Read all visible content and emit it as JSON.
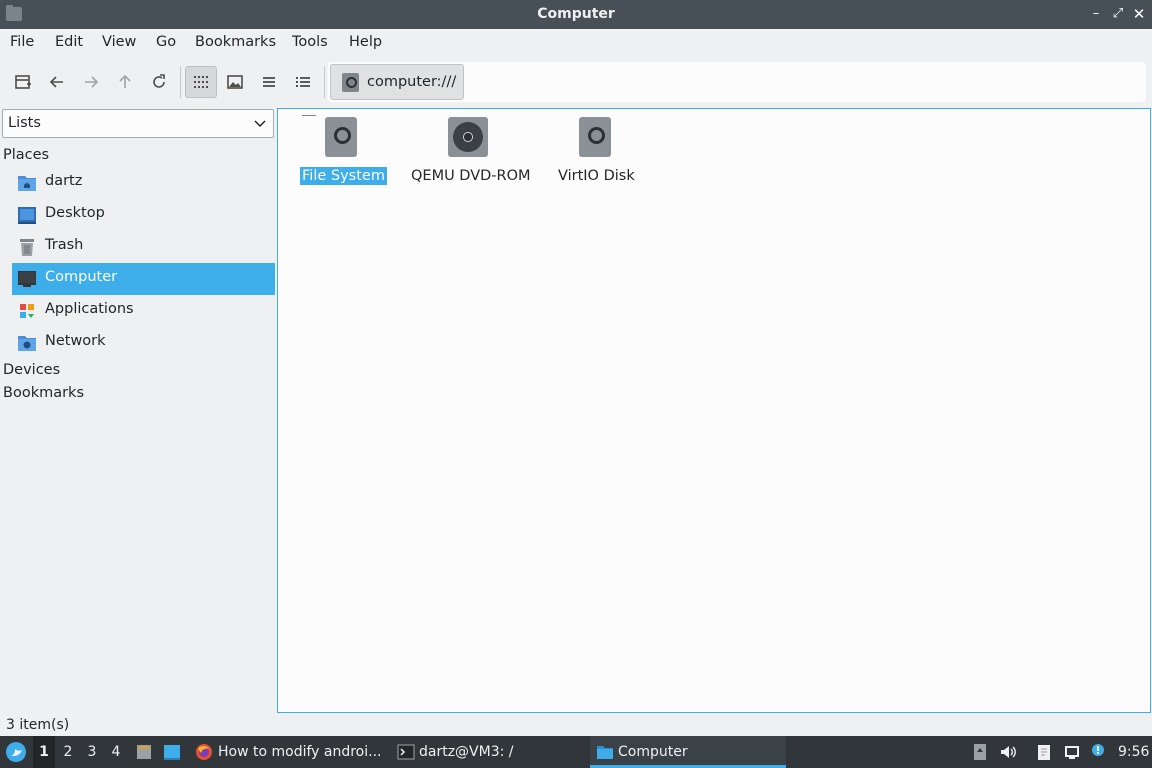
{
  "window": {
    "title": "Computer",
    "buttons": {
      "minimize": "–",
      "maximize": "⤢",
      "close": "✕"
    }
  },
  "menu": [
    "File",
    "Edit",
    "View",
    "Go",
    "Bookmarks",
    "Tools",
    "Help"
  ],
  "toolbar": {
    "buttons": [
      "new-tab-icon",
      "back-icon",
      "forward-icon",
      "up-icon",
      "reload-icon",
      "icon-view-icon",
      "thumbnail-view-icon",
      "compact-view-icon",
      "detailed-list-icon"
    ],
    "location": "computer:///"
  },
  "sidebar": {
    "mode": "Lists",
    "places_header": "Places",
    "places": [
      {
        "label": "dartz",
        "icon": "home-folder-icon"
      },
      {
        "label": "Desktop",
        "icon": "desktop-icon"
      },
      {
        "label": "Trash",
        "icon": "trash-icon"
      },
      {
        "label": "Computer",
        "icon": "computer-icon",
        "selected": true
      },
      {
        "label": "Applications",
        "icon": "applications-icon"
      },
      {
        "label": "Network",
        "icon": "network-folder-icon"
      }
    ],
    "devices_header": "Devices",
    "bookmarks_header": "Bookmarks"
  },
  "main": {
    "items": [
      {
        "label": "File System",
        "icon": "drive-harddisk-icon",
        "selected": true
      },
      {
        "label": "QEMU DVD-ROM",
        "icon": "drive-optical-icon"
      },
      {
        "label": "VirtIO Disk",
        "icon": "drive-harddisk-icon"
      }
    ]
  },
  "status": {
    "text": "3 item(s)"
  },
  "taskbar": {
    "workspaces": [
      "1",
      "2",
      "3",
      "4"
    ],
    "active_workspace": "1",
    "windows": [
      {
        "label": "How to modify androi...",
        "icon": "firefox-icon"
      },
      {
        "label": "dartz@VM3: /",
        "icon": "terminal-icon"
      },
      {
        "label": "Computer",
        "icon": "folder-icon",
        "active": true
      }
    ],
    "clock": "9:56"
  },
  "colors": {
    "accent": "#3daee9",
    "titlebar": "#475057",
    "taskbar": "#31363b"
  }
}
